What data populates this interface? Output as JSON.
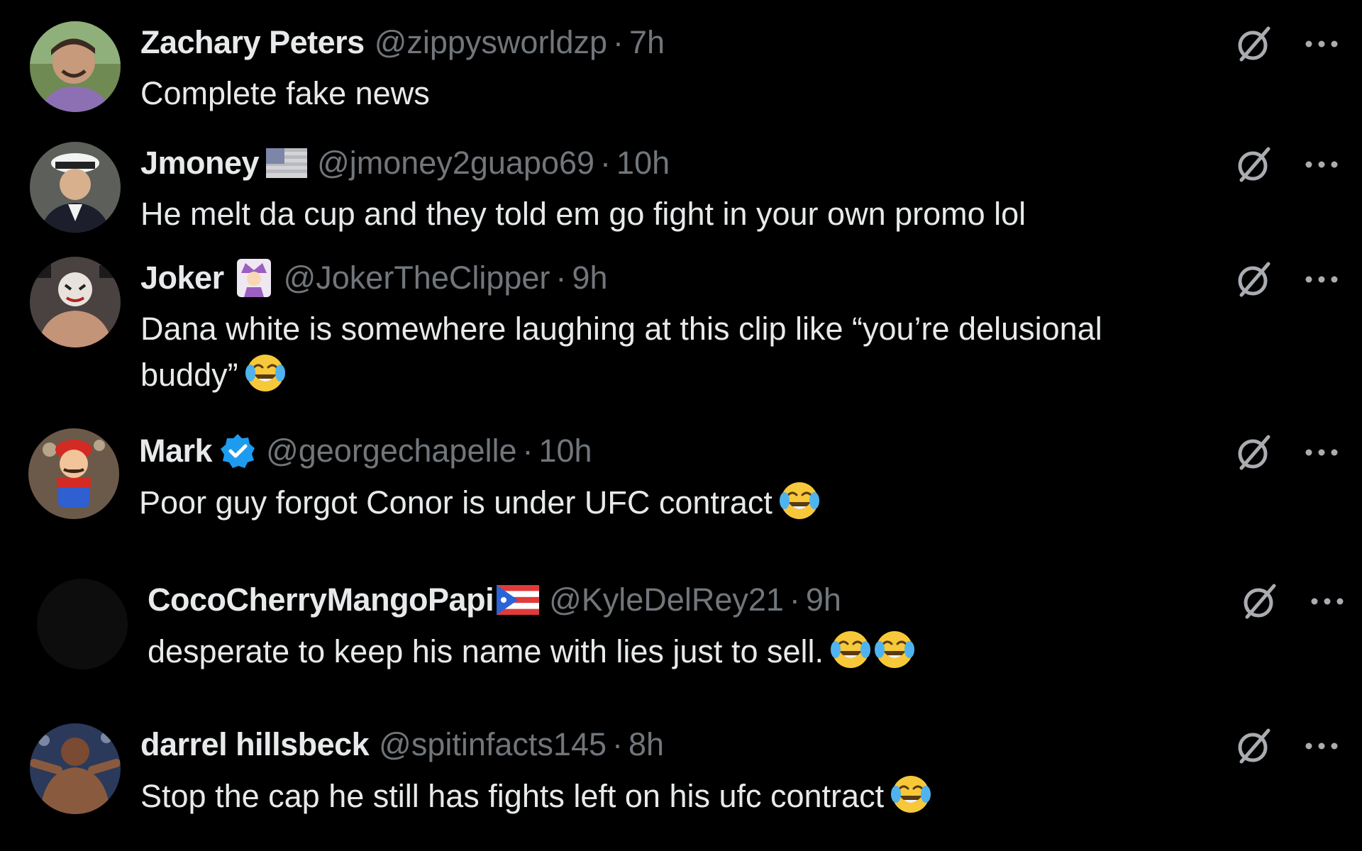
{
  "replies": [
    {
      "name": "Zachary Peters",
      "handle": "@zippysworldzp",
      "separator": "·",
      "time": "7h",
      "text": "Complete fake news",
      "avatar_icon": "user-avatar",
      "emoji_count": 0
    },
    {
      "name": "Jmoney",
      "name_badge": "us-flag-icon",
      "handle": "@jmoney2guapo69",
      "separator": "·",
      "time": "10h",
      "text": "He melt da cup and they told em go fight in your own promo lol",
      "avatar_icon": "user-avatar",
      "emoji_count": 0
    },
    {
      "name": "Joker",
      "name_badge": "joker-emoji-icon",
      "handle": "@JokerTheClipper",
      "separator": "·",
      "time": "9h",
      "text_line1": "Dana white is somewhere laughing at this clip like “you’re delusional",
      "text_line2": "buddy”",
      "avatar_icon": "user-avatar",
      "emoji_count": 1
    },
    {
      "name": "Mark",
      "name_badge": "verified-icon",
      "handle": "@georgechapelle",
      "separator": "·",
      "time": "10h",
      "text": "Poor guy forgot Conor is under UFC contract",
      "avatar_icon": "user-avatar",
      "emoji_count": 1
    },
    {
      "name": "CocoCherryMangoPapi",
      "name_badge": "puerto-rico-flag-icon",
      "handle": "@KyleDelRey21",
      "separator": "·",
      "time": "9h",
      "text": "desperate to keep his name with lies just to sell.",
      "avatar_icon": "user-avatar",
      "emoji_count": 2
    },
    {
      "name": "darrel hillsbeck",
      "handle": "@spitinfacts145",
      "separator": "·",
      "time": "8h",
      "text": "Stop the cap he still has fights left on his ufc contract",
      "avatar_icon": "user-avatar",
      "emoji_count": 1
    }
  ],
  "icons": {
    "grok": "grok-icon",
    "more": "more-options-icon",
    "emoji": "tears-of-joy-emoji"
  },
  "colors": {
    "background": "#000000",
    "text": "#e7e9ea",
    "muted": "#71767b",
    "verified": "#1d9bf0"
  }
}
